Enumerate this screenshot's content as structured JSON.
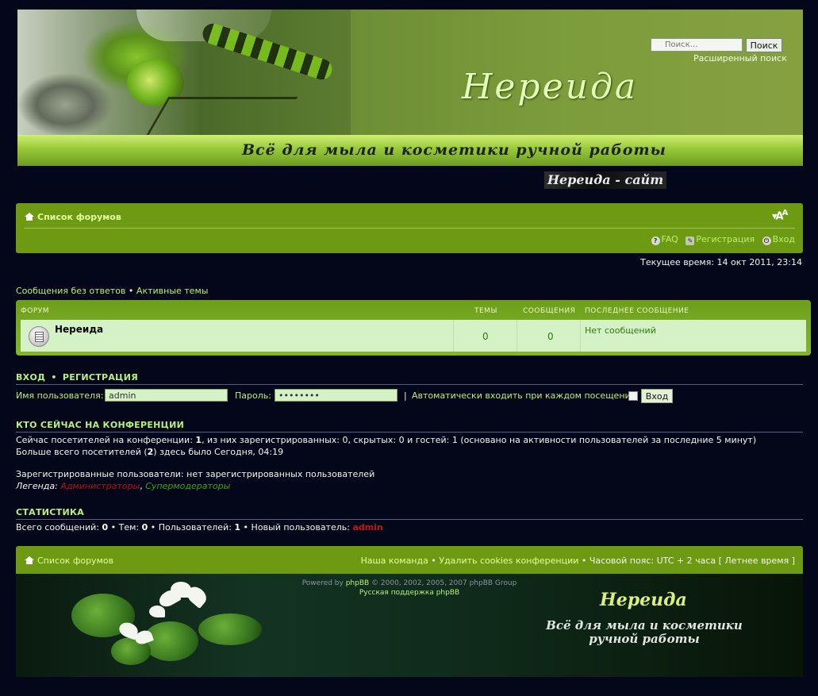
{
  "header": {
    "logo": "Нереида",
    "slogan": "Всё для мыла и косметики ручной работы",
    "site_link": "Нереида - сайт",
    "search_placeholder": "Поиск…",
    "search_button": "Поиск",
    "advanced_search": "Расширенный поиск"
  },
  "navbar": {
    "home": "Список форумов",
    "font_size_icon": "font-size-icon",
    "faq": "FAQ",
    "register": "Регистрация",
    "login": "Вход"
  },
  "current_time": "Текущее время: 14 окт 2011, 23:14",
  "quick_links": {
    "unanswered": "Сообщения без ответов",
    "separator": "•",
    "active": "Активные темы"
  },
  "forum_table": {
    "headers": {
      "forum": "ФОРУМ",
      "topics": "ТЕМЫ",
      "posts": "СООБЩЕНИЯ",
      "last_post": "ПОСЛЕДНЕЕ СООБЩЕНИЕ"
    },
    "rows": [
      {
        "name": "Нереида",
        "topics": "0",
        "posts": "0",
        "last_post": "Нет сообщений"
      }
    ]
  },
  "login": {
    "title_login": "ВХОД",
    "title_sep": "•",
    "title_register": "РЕГИСТРАЦИЯ",
    "username_label": "Имя пользователя:",
    "username_value": "admin",
    "password_label": "Пароль:",
    "password_value": "••••••••",
    "autologin_label": "Автоматически входить при каждом посещении",
    "submit": "Вход"
  },
  "who_online": {
    "title": "КТО СЕЙЧАС НА КОНФЕРЕНЦИИ",
    "line1_a": "Сейчас посетителей на конференции: ",
    "line1_total": "1",
    "line1_b": ", из них зарегистрированных: 0, скрытых: 0 и гостей: 1 (основано на активности пользователей за последние 5 минут)",
    "line2_a": "Больше всего посетителей (",
    "line2_max": "2",
    "line2_b": ") здесь было Сегодня, 04:19",
    "registered": "Зарегистрированные пользователи: нет зарегистрированных пользователей",
    "legend_label": "Легенда:",
    "legend_admins": "Администраторы",
    "legend_comma": ",",
    "legend_mods": "Супермодераторы"
  },
  "stats": {
    "title": "СТАТИСТИКА",
    "posts_label": "Всего сообщений: ",
    "posts": "0",
    "topics_label": " • Тем: ",
    "topics": "0",
    "users_label": " • Пользователей: ",
    "users": "1",
    "newest_label": " • Новый пользователь: ",
    "newest": "admin"
  },
  "footer": {
    "home": "Список форумов",
    "team": "Наша команда",
    "sep": "•",
    "delete_cookies": "Удалить cookies конференции",
    "timezone": "• Часовой пояс: UTC + 2 часа [ Летнее время ]",
    "powered_pre": "Powered by ",
    "phpbb": "phpBB",
    "powered_post": " © 2000, 2002, 2005, 2007 phpBB Group",
    "russian_support": "Русская поддержка phpBB",
    "logo": "Нереида",
    "slogan_line1": "Всё для мыла и косметики",
    "slogan_line2": "ручной работы"
  },
  "colors": {
    "accent": "#6d9a12",
    "link": "#b7f07a",
    "background": "#04061a",
    "admin": "#b01212",
    "moderator": "#2fa51b"
  }
}
